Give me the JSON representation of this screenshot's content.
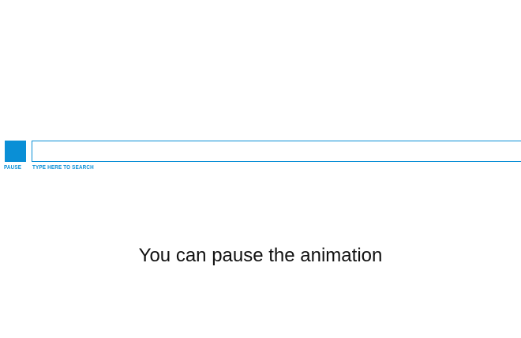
{
  "controls": {
    "pause_label": "PAUSE",
    "search_hint": "TYPE HERE TO SEARCH",
    "search_value": ""
  },
  "message": {
    "text": "You can pause the animation"
  },
  "colors": {
    "accent": "#0a8fd6",
    "text": "#111111",
    "background": "#ffffff"
  }
}
